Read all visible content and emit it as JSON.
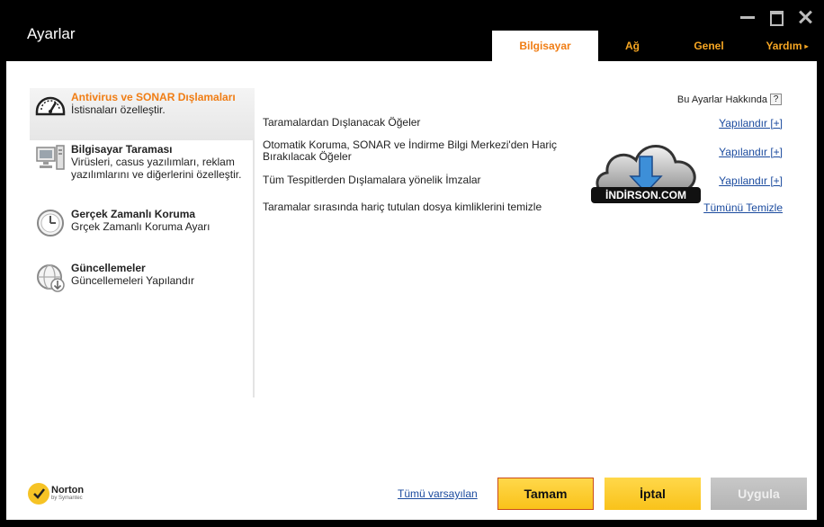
{
  "window": {
    "title": "Ayarlar"
  },
  "tabs": [
    {
      "label": "Bilgisayar",
      "active": true
    },
    {
      "label": "Ağ",
      "active": false
    },
    {
      "label": "Genel",
      "active": false
    },
    {
      "label": "Yardım",
      "active": false,
      "arrow": "▸"
    }
  ],
  "sidebar": {
    "items": [
      {
        "title": "Antivirus ve SONAR Dışlamaları",
        "desc": "İstisnaları özelleştir.",
        "icon": "gauge-icon",
        "active": true
      },
      {
        "title": "Bilgisayar Taraması",
        "desc": "Virüsleri, casus yazılımları, reklam yazılımlarını ve diğerlerini özelleştir.",
        "icon": "computer-icon",
        "active": false
      },
      {
        "title": "Gerçek Zamanlı Koruma",
        "desc": "Grçek Zamanlı Koruma Ayarı",
        "icon": "clock-icon",
        "active": false
      },
      {
        "title": "Güncellemeler",
        "desc": "Güncellemeleri Yapılandır",
        "icon": "globe-update-icon",
        "active": false
      }
    ]
  },
  "panel": {
    "about_label": "Bu Ayarlar Hakkında",
    "help_glyph": "?",
    "rows": [
      {
        "label": "Taramalardan Dışlanacak Öğeler",
        "link": "Yapılandır [+]"
      },
      {
        "label": "Otomatik Koruma, SONAR ve İndirme Bilgi Merkezi'den Hariç Bırakılacak Öğeler",
        "link": "Yapılandır [+]"
      },
      {
        "label": "Tüm Tespitlerden Dışlamalara yönelik İmzalar",
        "link": "Yapılandır [+]"
      },
      {
        "label": "Taramalar sırasında hariç tutulan dosya kimliklerini temizle",
        "link": "Tümünü Temizle"
      }
    ],
    "watermark_text": "İNDİRSON.COM"
  },
  "footer": {
    "defaults_link": "Tümü varsayılan",
    "ok_label": "Tamam",
    "cancel_label": "İptal",
    "apply_label": "Uygula",
    "logo_name": "Norton",
    "logo_sub": "by Symantec"
  },
  "colors": {
    "accent_orange": "#f07d14",
    "tab_orange": "#f6a623",
    "button_yellow": "#f9c21a",
    "link_blue": "#1a4a9e"
  }
}
